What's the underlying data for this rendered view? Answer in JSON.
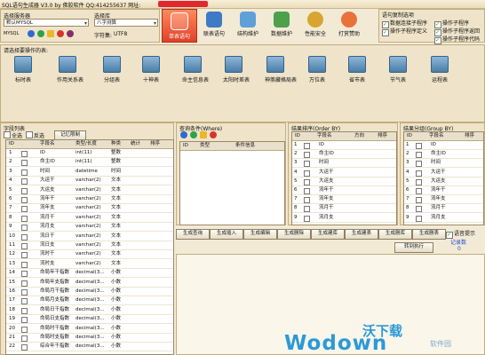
{
  "window": {
    "title": "SQL语句生成器 V3.0 by 佛胶软件  QQ:414255637 网址:"
  },
  "left_top": {
    "server_label": "选择服务器",
    "server_value": "默认MYSQL",
    "server_type": "MYSQL",
    "db_label": "选择库",
    "db_value": "八字测算",
    "charset_label": "字符集:",
    "charset_value": "UTF8"
  },
  "toolbar": [
    "单表语句",
    "联表语句",
    "结构维护",
    "数据维护",
    "性能安全",
    "打赏赞助"
  ],
  "options": {
    "title": "语句复制选项",
    "items": [
      {
        "label": "数据连接子程序",
        "checked": true
      },
      {
        "label": "操作子程序",
        "checked": true
      },
      {
        "label": "操作子程序定义",
        "checked": true
      },
      {
        "label": "操作子程序返回",
        "checked": true
      },
      {
        "label": "操作子程序代码",
        "checked": true
      }
    ]
  },
  "tables": {
    "label": "请选择要操作的表:",
    "items": [
      "标时表",
      "作用关系表",
      "分组表",
      "十神表",
      "命主信息表",
      "太阳时差表",
      "神煞藏格局表",
      "万位表",
      "省市表",
      "节气表",
      "运程表"
    ]
  },
  "fields": {
    "title": "字段列表",
    "select_all": "全选",
    "invert": "反选",
    "remember": "记忆限制",
    "columns": [
      "ID",
      "字段名",
      "类型/长度",
      "种类",
      "统计",
      "排序"
    ],
    "rows": [
      [
        "1",
        "ID",
        "int(11)",
        "整数"
      ],
      [
        "2",
        "命主ID",
        "int(11)",
        "整数"
      ],
      [
        "3",
        "时间",
        "datetime",
        "时间"
      ],
      [
        "4",
        "大运干",
        "varchar(2)",
        "文本"
      ],
      [
        "5",
        "大运支",
        "varchar(2)",
        "文本"
      ],
      [
        "6",
        "流年干",
        "varchar(2)",
        "文本"
      ],
      [
        "7",
        "流年支",
        "varchar(2)",
        "文本"
      ],
      [
        "8",
        "流月干",
        "varchar(2)",
        "文本"
      ],
      [
        "9",
        "流月支",
        "varchar(2)",
        "文本"
      ],
      [
        "10",
        "流日干",
        "varchar(2)",
        "文本"
      ],
      [
        "11",
        "流日支",
        "varchar(2)",
        "文本"
      ],
      [
        "12",
        "流时干",
        "varchar(2)",
        "文本"
      ],
      [
        "13",
        "流时支",
        "varchar(2)",
        "文本"
      ],
      [
        "14",
        "命局年干指数",
        "decimal(3...",
        "小数"
      ],
      [
        "15",
        "命局年支指数",
        "decimal(3...",
        "小数"
      ],
      [
        "16",
        "命局月干指数",
        "decimal(3...",
        "小数"
      ],
      [
        "17",
        "命局月支指数",
        "decimal(3...",
        "小数"
      ],
      [
        "18",
        "命局日干指数",
        "decimal(3...",
        "小数"
      ],
      [
        "19",
        "命局日支指数",
        "decimal(3...",
        "小数"
      ],
      [
        "20",
        "命局时干指数",
        "decimal(3...",
        "小数"
      ],
      [
        "21",
        "命局时支指数",
        "decimal(3...",
        "小数"
      ],
      [
        "22",
        "综合年干指数",
        "decimal(3...",
        "小数"
      ]
    ]
  },
  "query": {
    "title": "查询条件(Where)",
    "columns": [
      "ID",
      "类型",
      "条件信息"
    ]
  },
  "order": {
    "title": "结果排序(Order BY)",
    "columns": [
      "ID",
      "字段名",
      "方向",
      "排序"
    ],
    "rows": [
      [
        "1",
        "ID"
      ],
      [
        "2",
        "命主ID"
      ],
      [
        "3",
        "时间"
      ],
      [
        "4",
        "大运干"
      ],
      [
        "5",
        "大运支"
      ],
      [
        "6",
        "流年干"
      ],
      [
        "7",
        "流年支"
      ],
      [
        "8",
        "流月干"
      ],
      [
        "9",
        "流月支"
      ]
    ]
  },
  "group": {
    "title": "结果分组(Group BY)",
    "columns": [
      "ID",
      "字段名",
      "排序"
    ],
    "rows": [
      [
        "1",
        "ID"
      ],
      [
        "2",
        "命主ID"
      ],
      [
        "3",
        "时间"
      ],
      [
        "4",
        "大运干"
      ],
      [
        "5",
        "大运支"
      ],
      [
        "6",
        "流年干"
      ],
      [
        "7",
        "流年支"
      ],
      [
        "8",
        "流月干"
      ],
      [
        "9",
        "流月支"
      ]
    ]
  },
  "actions": {
    "row1": [
      "生成查询",
      "生成插入",
      "生成编辑",
      "生成删除",
      "生成建库",
      "生成建表",
      "生成删库",
      "生成删表"
    ],
    "execute": "转到执行",
    "voice": "语音提示",
    "record_label": "记录数",
    "record_value": "0"
  },
  "watermark": {
    "brand": "Wodown",
    "cn": "沃下载",
    "sub": "软件园"
  },
  "colors": {
    "accent": "#e0402a",
    "panel": "#efe4c9",
    "border": "#c2ad80"
  }
}
